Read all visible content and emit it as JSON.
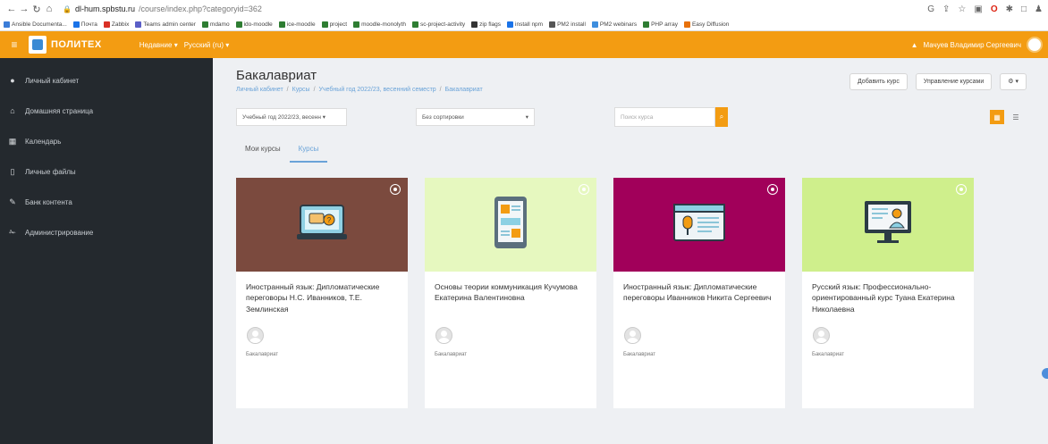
{
  "browser": {
    "host": "dl-hum.spbstu.ru",
    "path": "/course/index.php?categoryid=362",
    "bookmarks": [
      "Ansible Documenta...",
      "Почта",
      "Zabbix",
      "Teams admin center",
      "mdamo",
      "ido-moodle",
      "ice-moodle",
      "project",
      "moodle-monolyth",
      "sc-project-activity",
      "zip flags",
      "install npm",
      "PM2 install",
      "PM2 webinars",
      "PHP array",
      "Easy Diffusion"
    ],
    "bookmark_colors": [
      "#3b7dd8",
      "#1a73e8",
      "#d93025",
      "#5b5fc7",
      "#2e7d32",
      "#2e7d32",
      "#2e7d32",
      "#2e7d32",
      "#2e7d32",
      "#2e7d32",
      "#333333",
      "#1a73e8",
      "#555555",
      "#3e8ede",
      "#2e7d32",
      "#e8710a",
      "#5c6bc0"
    ]
  },
  "header": {
    "logo_text": "ПОЛИТЕХ",
    "menu_items": [
      "Недавние ▾",
      "Русский (ru) ▾"
    ],
    "user_name": "Мачуев Владимир Сергеевич"
  },
  "sidebar": {
    "items": [
      {
        "label": "Личный кабинет",
        "icon": "gauge-icon",
        "glyph": "●"
      },
      {
        "label": "Домашняя страница",
        "icon": "home-icon",
        "glyph": "⌂"
      },
      {
        "label": "Календарь",
        "icon": "calendar-icon",
        "glyph": "▦"
      },
      {
        "label": "Личные файлы",
        "icon": "file-icon",
        "glyph": "▯"
      },
      {
        "label": "Банк контента",
        "icon": "pencil-icon",
        "glyph": "✎"
      },
      {
        "label": "Администрирование",
        "icon": "wrench-icon",
        "glyph": "✁"
      }
    ]
  },
  "page": {
    "title": "Бакалавриат",
    "breadcrumb": [
      "Личный кабинет",
      "Курсы",
      "Учебный год 2022/23, весенний семестр",
      "Бакалавриат"
    ],
    "add_course": "Добавить курс",
    "manage_courses": "Управление курсами",
    "gear_label": "⚙ ▾"
  },
  "filters": {
    "year_select": "Учебный год 2022/23, весенн ▾",
    "sort_select": "Без сортировки",
    "search_placeholder": "Поиск курса"
  },
  "tabs": [
    "Мои курсы",
    "Курсы"
  ],
  "cards": [
    {
      "title": "Иностранный язык: Дипломатические переговоры Н.С. Иванников, Т.Е. Землинская",
      "category": "Бакалавриат",
      "color": "#7b4a3e"
    },
    {
      "title": "Основы теории коммуникация Кучумова Екатерина Валентиновна",
      "category": "Бакалавриат",
      "color": "#e6f8bf"
    },
    {
      "title": "Иностранный язык: Дипломатические переговоры Иванников Никита Сергеевич",
      "category": "Бакалавриат",
      "color": "#a1005a"
    },
    {
      "title": "Русский язык: Профессионально-ориентированный курс Туана Екатерина Николаевна",
      "category": "Бакалавриат",
      "color": "#cfef8c"
    }
  ],
  "colors": {
    "accent": "#f39c12",
    "sidebar": "#24292e",
    "link": "#6aa3d8"
  }
}
